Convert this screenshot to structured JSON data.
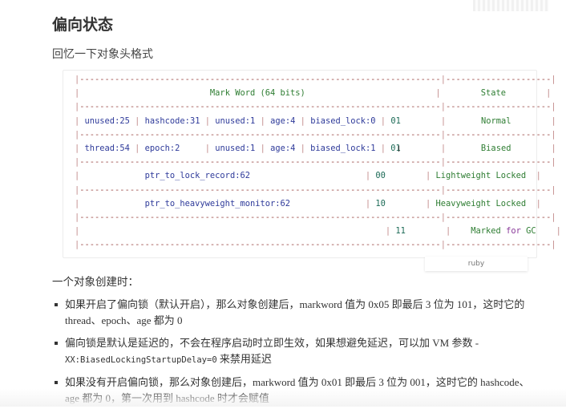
{
  "heading": "偏向状态",
  "subtitle": "回忆一下对象头格式",
  "code": {
    "language": "ruby",
    "header": {
      "markword": "Mark Word (64 bits)",
      "state": "State"
    },
    "rows": [
      {
        "fields": [
          "unused:25",
          "hashcode:31",
          "unused:1",
          "age:4",
          "biased_lock:0"
        ],
        "bits": "01",
        "state": "Normal"
      },
      {
        "fields": [
          "thread:54",
          "epoch:2",
          "unused:1",
          "age:4",
          "biased_lock:1"
        ],
        "bits": "01",
        "state": "Biased"
      },
      {
        "fields": [
          "ptr_to_lock_record:62"
        ],
        "bits": "00",
        "state": "Lightweight Locked"
      },
      {
        "fields": [
          "ptr_to_heavyweight_monitor:62"
        ],
        "bits": "10",
        "state": "Heavyweight Locked"
      },
      {
        "fields": [],
        "bits": "11",
        "state": "Marked for GC"
      }
    ]
  },
  "paragraph": "一个对象创建时：",
  "bullets": [
    {
      "text1": "如果开启了偏向锁（默认开启），那么对象创建后，markword 值为 0x05 即最后 3 位为 101，这时它的 thread、epoch、age 都为 0"
    },
    {
      "text1": "偏向锁是默认是延迟的，不会在程序启动时立即生效，如果想避免延迟，可以加 VM 参数 -",
      "code": "XX:BiasedLockingStartupDelay=0",
      "text2": " 来禁用延迟"
    },
    {
      "text1": "如果没有开启偏向锁，那么对象创建后，markword 值为 0x01 即最后 3 位为 001，这时它的 hashcode、age 都为 0，第一次用到 hashcode 时才会赋值"
    }
  ]
}
